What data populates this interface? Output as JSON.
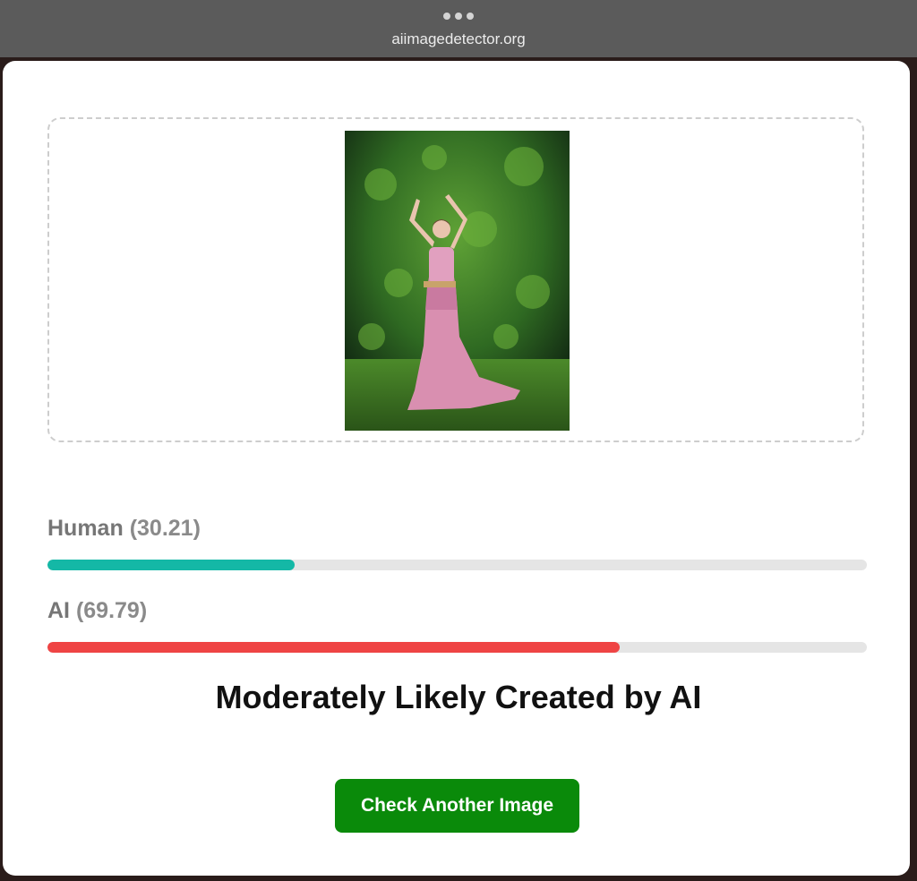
{
  "browser": {
    "url": "aiimagedetector.org",
    "menu_icon": "more-dots-icon"
  },
  "uploaded_image": {
    "icon": "uploaded-photo"
  },
  "results": {
    "human": {
      "label": "Human",
      "score_text": "(30.21)",
      "value": 30.21,
      "color": "#14b8a6"
    },
    "ai": {
      "label": "AI",
      "score_text": "(69.79)",
      "value": 69.79,
      "color": "#ef4444"
    }
  },
  "verdict": "Moderately Likely Created by AI",
  "button": {
    "label": "Check Another Image",
    "color": "#0a8a0a"
  }
}
